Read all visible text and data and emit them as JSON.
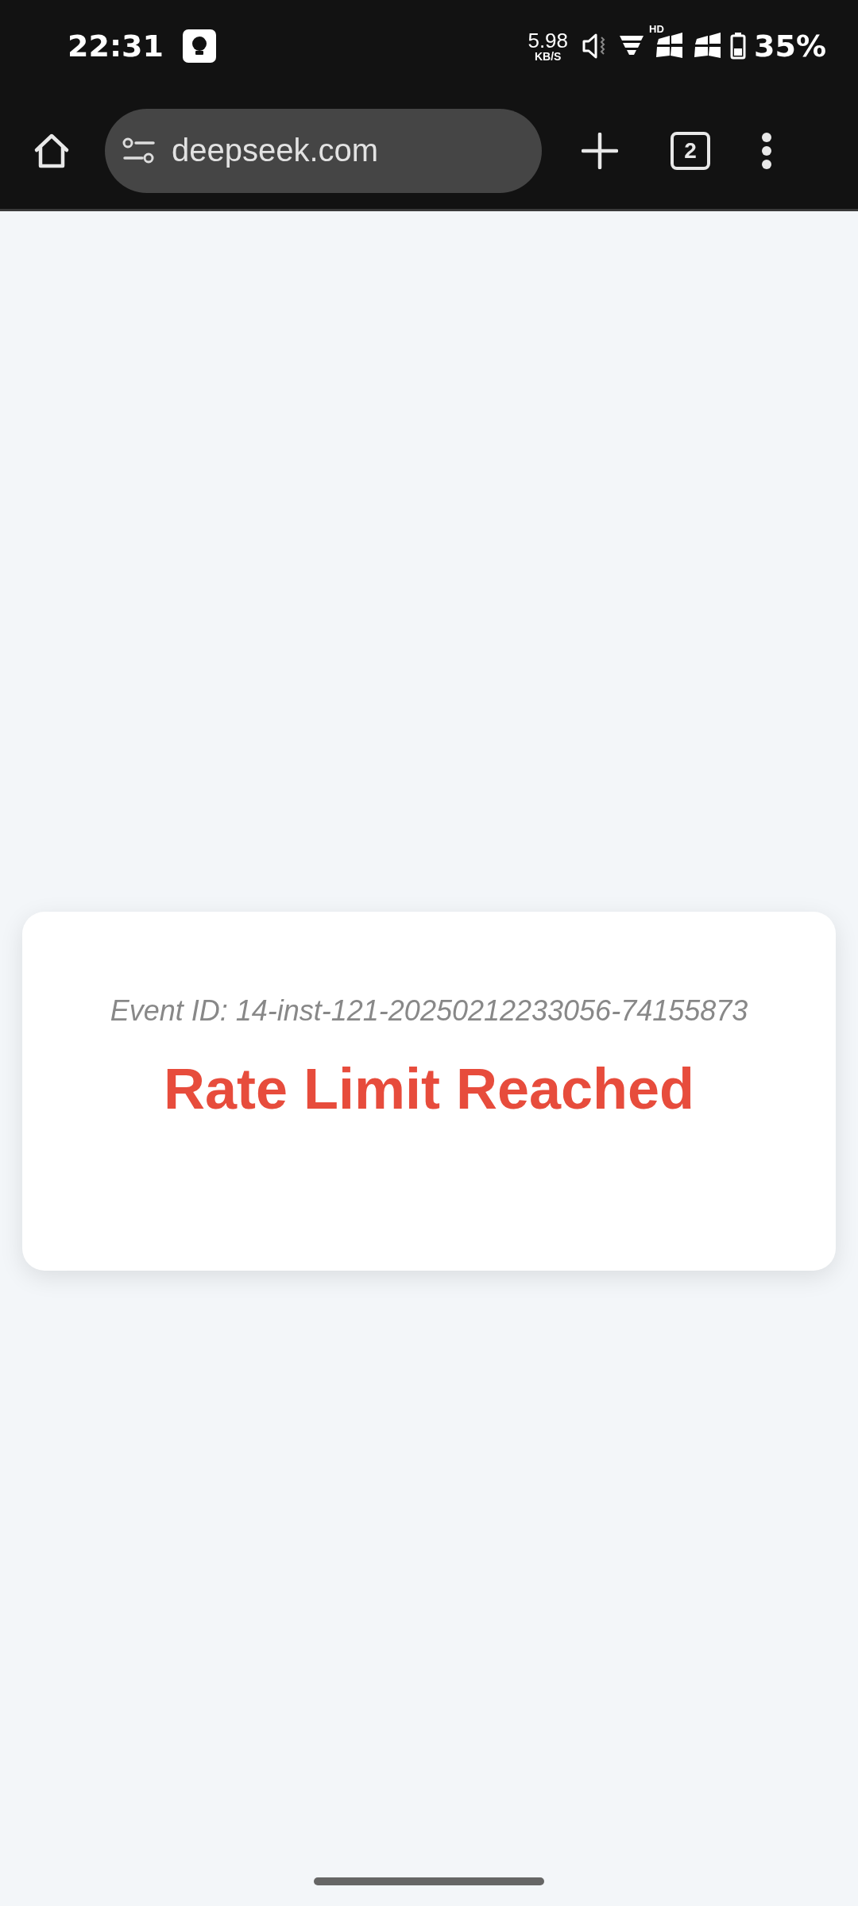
{
  "status_bar": {
    "time": "22:31",
    "network_speed": "5.98",
    "network_unit": "KB/S",
    "signal_label": "HD",
    "battery": "35%"
  },
  "browser_toolbar": {
    "url": "deepseek.com",
    "tab_count": "2"
  },
  "error_card": {
    "event_id": "Event ID: 14-inst-121-20250212233056-74155873",
    "title": "Rate Limit Reached"
  }
}
